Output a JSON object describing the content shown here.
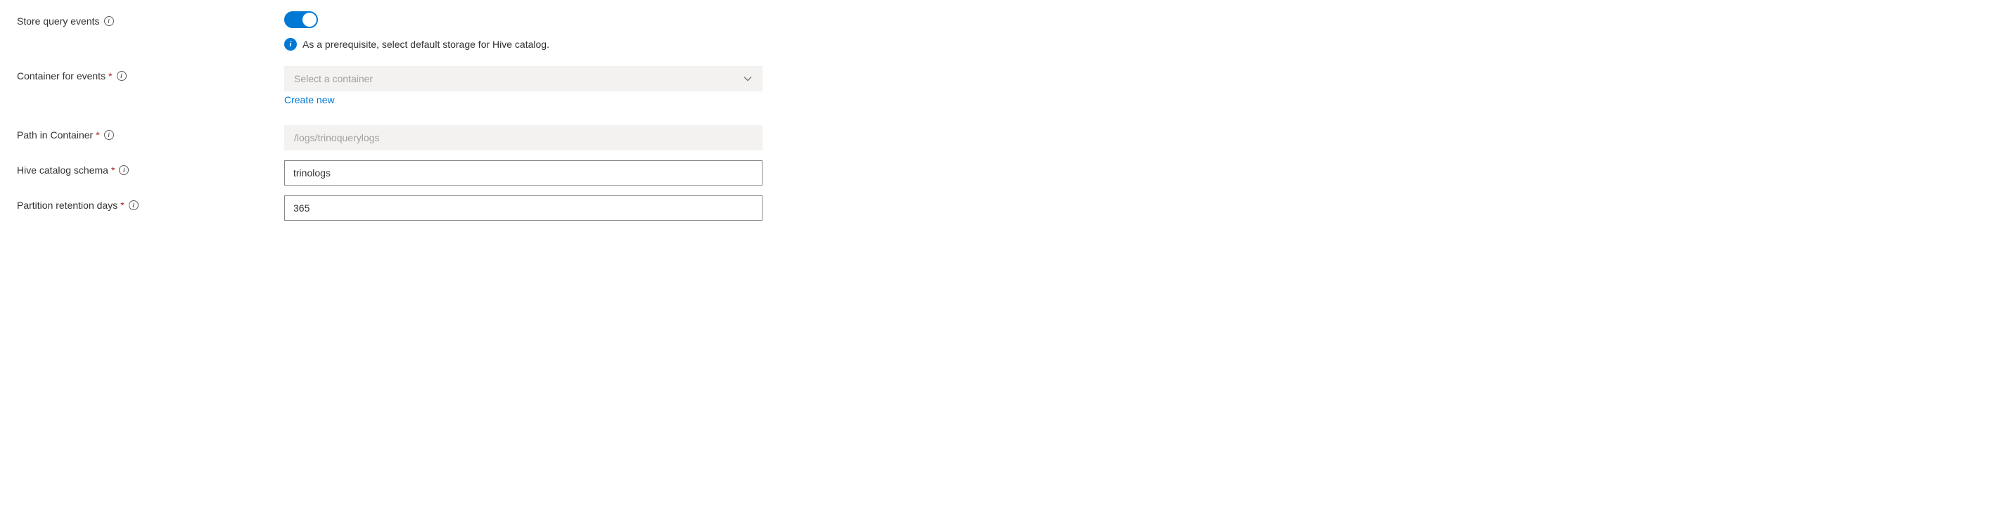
{
  "storeQueryEvents": {
    "label": "Store query events",
    "enabled": true,
    "helper": "As a prerequisite, select default storage for Hive catalog."
  },
  "containerForEvents": {
    "label": "Container for events",
    "placeholder": "Select a container",
    "createNew": "Create new"
  },
  "pathInContainer": {
    "label": "Path in Container",
    "placeholder": "/logs/trinoquerylogs"
  },
  "hiveCatalogSchema": {
    "label": "Hive catalog schema",
    "value": "trinologs"
  },
  "partitionRetentionDays": {
    "label": "Partition retention days",
    "value": "365"
  }
}
